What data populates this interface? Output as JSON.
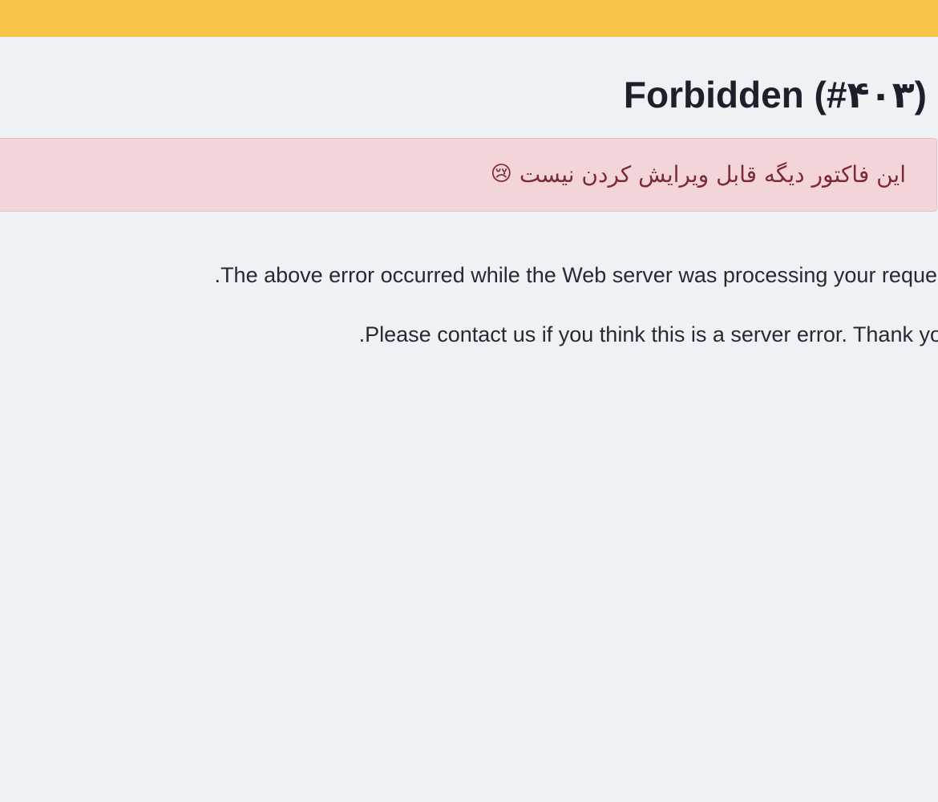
{
  "header": {
    "accent_color": "#f7c348"
  },
  "page": {
    "title": "Forbidden (#۴۰۳)"
  },
  "alert": {
    "message": "این فاکتور دیگه قابل ویرایش کردن نیست",
    "emoji": "😢",
    "background_color": "#f3d5d9",
    "text_color": "#7c2b34"
  },
  "body": {
    "paragraph_1": "The above error occurred while the Web server was processing your request.",
    "paragraph_2": "Please contact us if you think this is a server error. Thank you."
  }
}
